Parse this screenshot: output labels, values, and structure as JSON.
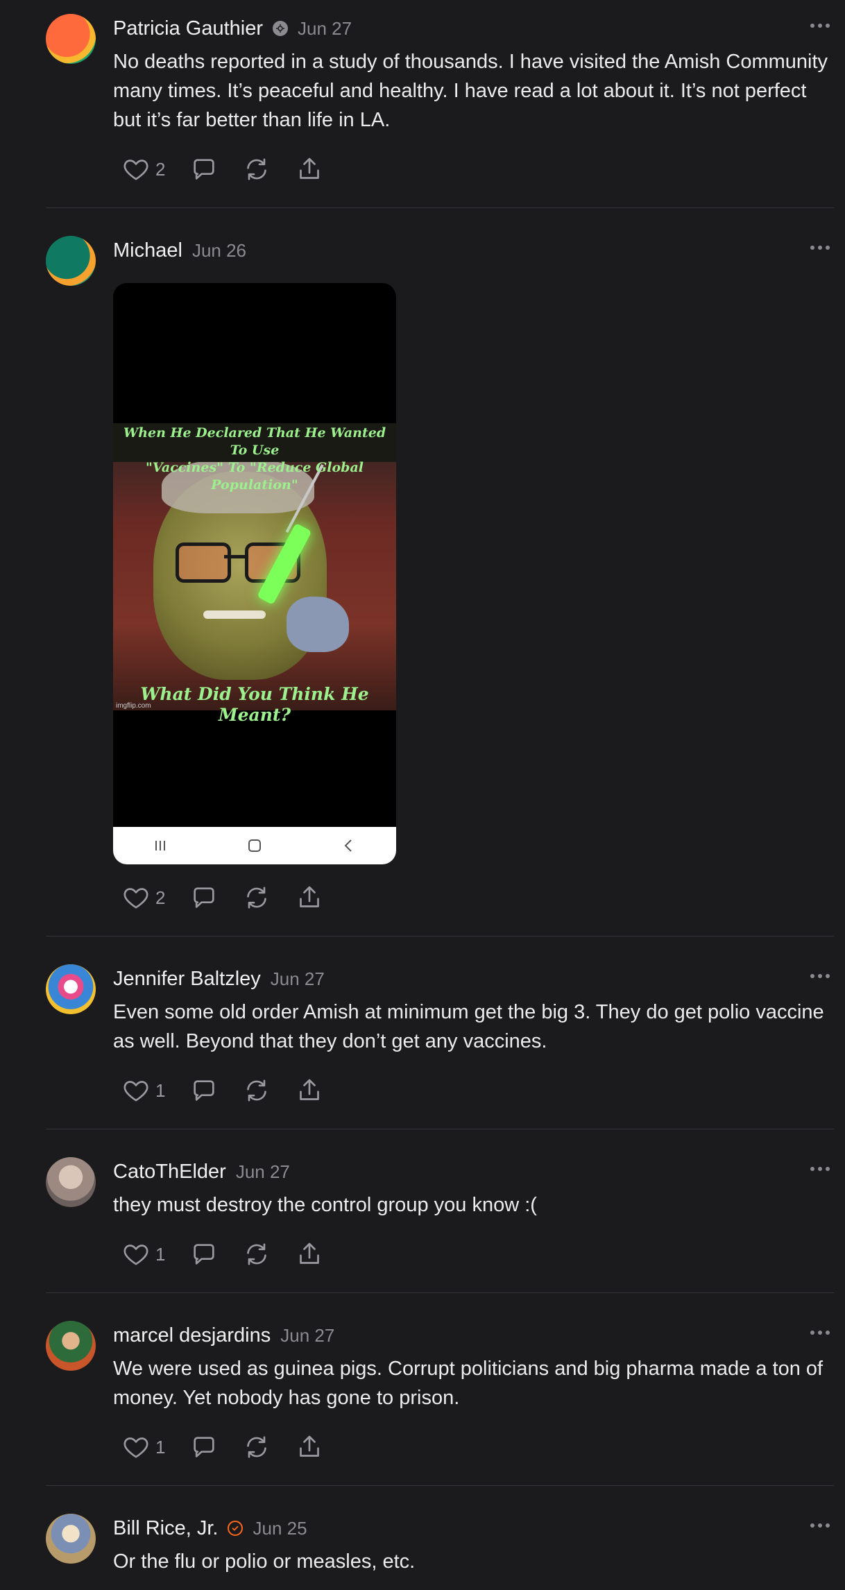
{
  "posts": [
    {
      "name": "Patricia Gauthier",
      "date": "Jun 27",
      "text": "No deaths reported in a study of thousands. I have visited the Amish Community many times. It’s peaceful and healthy. I have read a lot about it. It’s not perfect but it’s far better than life in LA.",
      "likes": "2"
    },
    {
      "name": "Michael",
      "date": "Jun 26",
      "media": {
        "caption_top_line1": "When He Declared That He Wanted To Use",
        "caption_top_line2": "\"Vaccines\" To \"Reduce Global Population\"",
        "caption_bottom": "What Did You Think He Meant?",
        "watermark": "imgflip.com"
      },
      "likes": "2"
    },
    {
      "name": "Jennifer Baltzley",
      "date": "Jun 27",
      "text": "Even some old order Amish at minimum get the big 3. They do get polio vaccine as well. Beyond that they don’t get any vaccines.",
      "likes": "1"
    },
    {
      "name": "CatoThElder",
      "date": "Jun 27",
      "text": "they must destroy the control group you know :(",
      "likes": "1"
    },
    {
      "name": "marcel desjardins",
      "date": "Jun 27",
      "text": "We were used as guinea pigs. Corrupt politicians and big pharma made a ton of money. Yet nobody has gone to prison.",
      "likes": "1"
    },
    {
      "name": "Bill Rice, Jr.",
      "date": "Jun 25",
      "text": "Or the flu or polio or measles, etc."
    }
  ],
  "icons": {
    "like": "heart-icon",
    "comment": "comment-icon",
    "restack": "restack-icon",
    "share": "share-icon",
    "more": "more-icon"
  },
  "colors": {
    "background": "#1b1b1d",
    "accent_badge": "#ff6719"
  }
}
